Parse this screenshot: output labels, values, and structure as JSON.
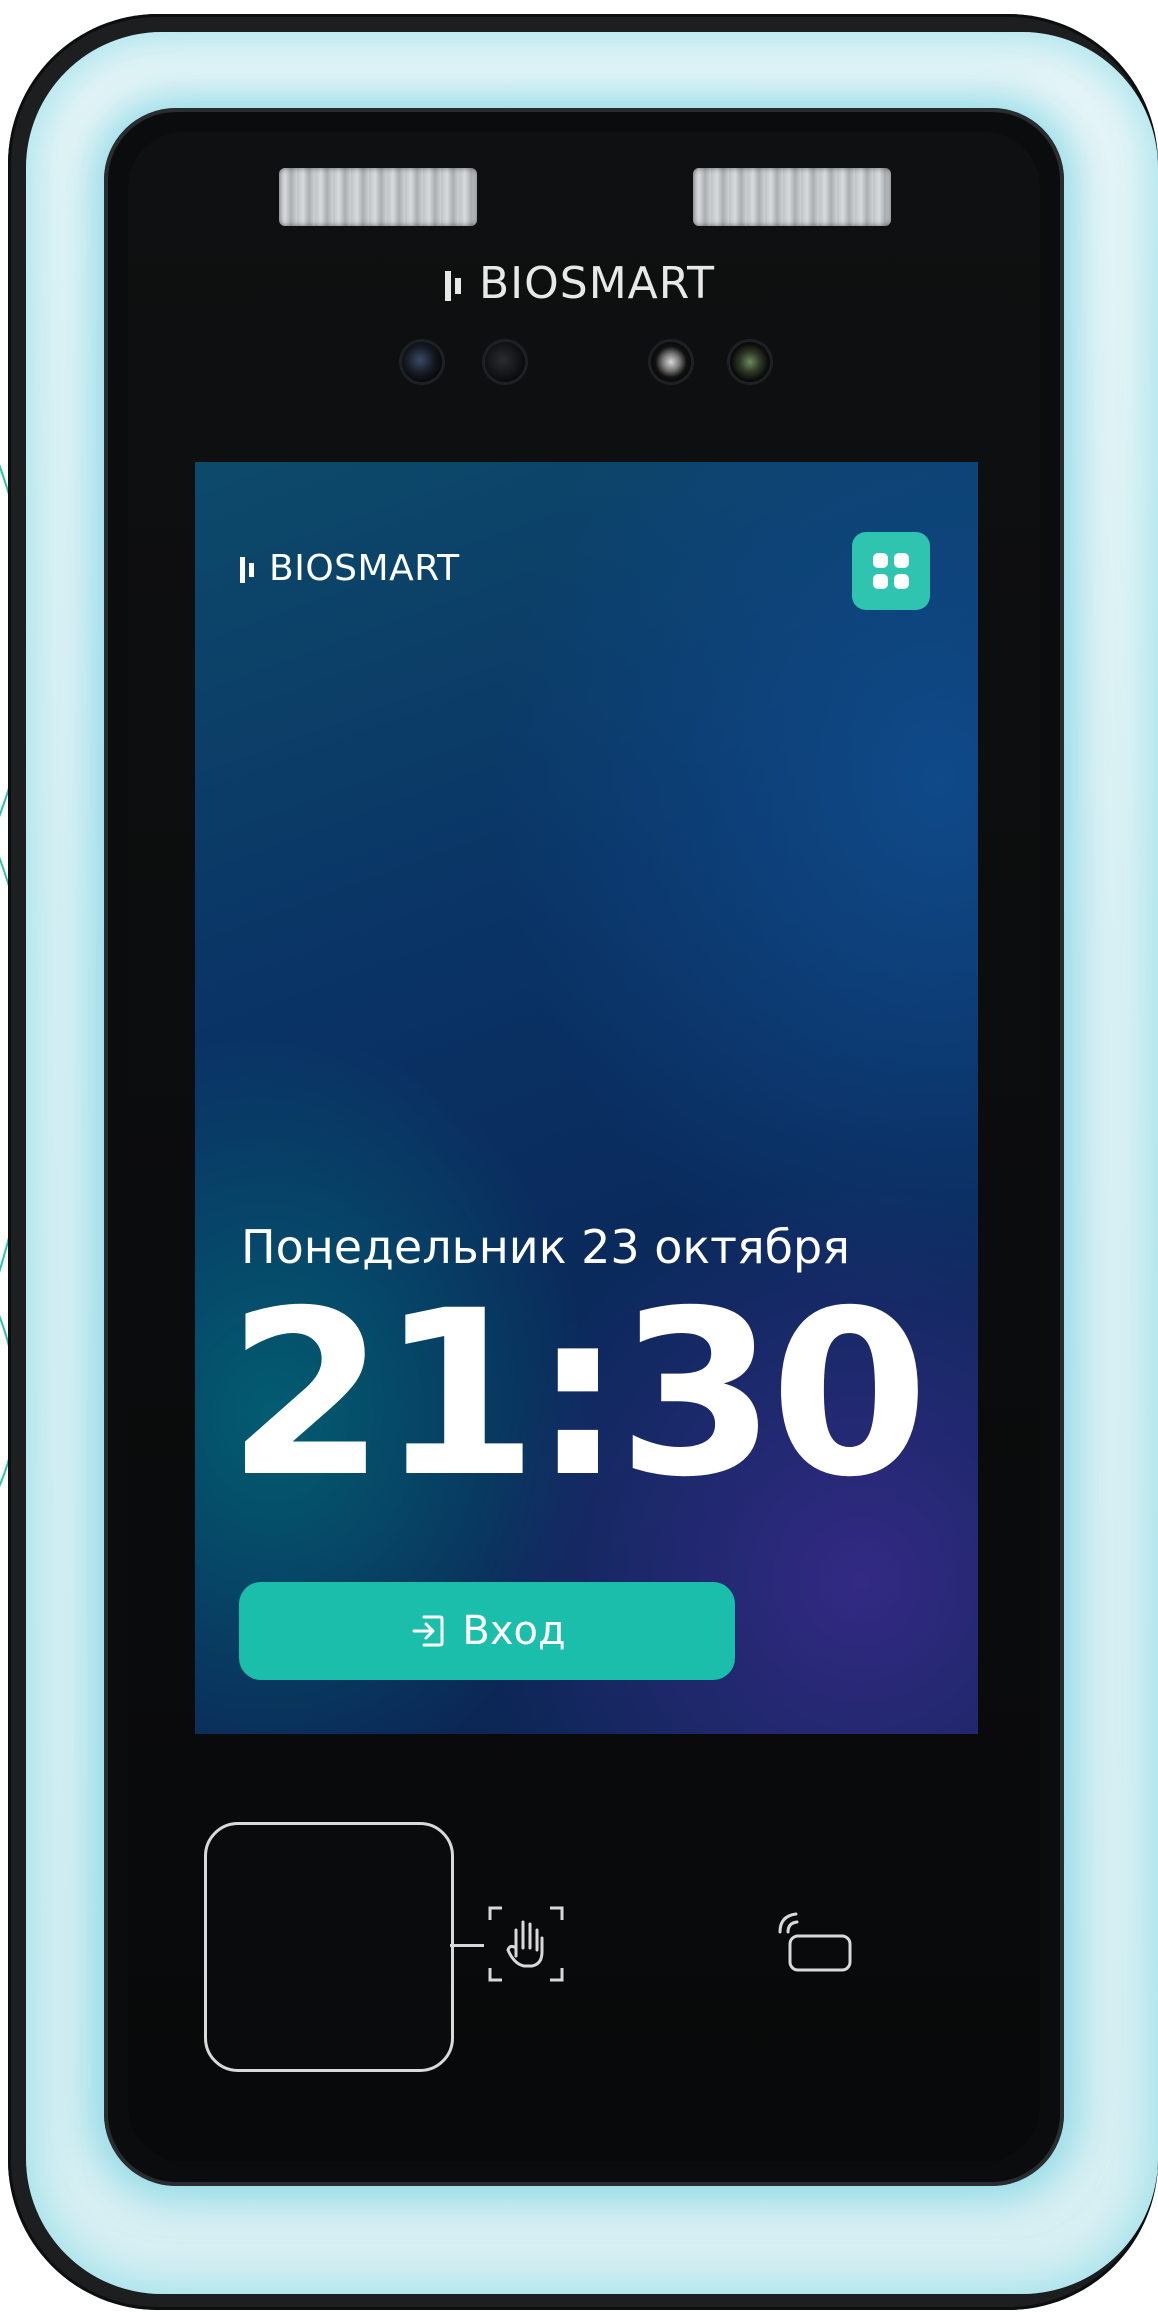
{
  "device": {
    "brand": "BIOSMART"
  },
  "screen": {
    "brand": "BIOSMART",
    "date": "Понедельник 23 октября",
    "time": "21:30",
    "entry_button_label": "Вход"
  },
  "colors": {
    "accent": "#1bbdab",
    "menu_button": "#2ec4b0",
    "glow": "#78d7e4",
    "housing": "#1c1e20"
  },
  "icons": {
    "menu": "grid-icon",
    "entry": "login-arrow-icon",
    "palm": "palm-scan-icon",
    "card": "contactless-card-icon",
    "logo": "biosmart-logo-mark"
  }
}
